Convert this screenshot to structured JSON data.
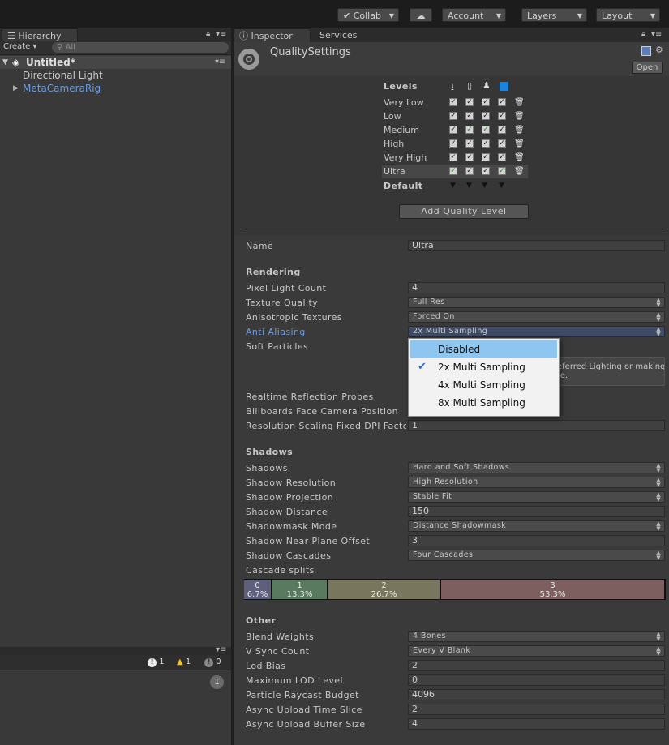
{
  "toolbar": {
    "collab": "Collab",
    "account": "Account",
    "layers": "Layers",
    "layout": "Layout"
  },
  "hierarchy": {
    "tab": "Hierarchy",
    "create": "Create",
    "search_placeholder": "All",
    "scene": "Untitled*",
    "items": [
      "Directional Light",
      "MetaCameraRig"
    ]
  },
  "console": {
    "errors": "1",
    "warnings": "1",
    "messages": "0",
    "collapsed_count": "1"
  },
  "inspector": {
    "tab": "Inspector",
    "services_tab": "Services",
    "title": "QualitySettings",
    "open": "Open",
    "levels_header": "Levels",
    "default_label": "Default",
    "levels": [
      {
        "name": "Very Low",
        "checks": [
          "✓",
          "✓",
          "✓",
          "✓"
        ],
        "green": [
          false,
          false,
          false,
          false
        ]
      },
      {
        "name": "Low",
        "checks": [
          "✓",
          "✓",
          "✓",
          "✓"
        ],
        "green": [
          false,
          false,
          false,
          false
        ]
      },
      {
        "name": "Medium",
        "checks": [
          "✓",
          "✓",
          "✓",
          "✓"
        ],
        "green": [
          false,
          true,
          true,
          false
        ]
      },
      {
        "name": "High",
        "checks": [
          "✓",
          "✓",
          "✓",
          "✓"
        ],
        "green": [
          false,
          false,
          false,
          false
        ]
      },
      {
        "name": "Very High",
        "checks": [
          "✓",
          "✓",
          "✓",
          "✓"
        ],
        "green": [
          false,
          false,
          false,
          false
        ]
      },
      {
        "name": "Ultra",
        "checks": [
          "✓",
          "✓",
          "✓",
          "✓"
        ],
        "green": [
          true,
          false,
          false,
          true
        ]
      }
    ],
    "add_level": "Add Quality Level",
    "name_label": "Name",
    "name_value": "Ultra",
    "rendering": {
      "header": "Rendering",
      "pixel_light_count": {
        "label": "Pixel Light Count",
        "value": "4"
      },
      "texture_quality": {
        "label": "Texture Quality",
        "value": "Full Res"
      },
      "anisotropic": {
        "label": "Anisotropic Textures",
        "value": "Forced On"
      },
      "anti_aliasing": {
        "label": "Anti Aliasing",
        "value": "2x Multi Sampling"
      },
      "soft_particles": {
        "label": "Soft Particles"
      },
      "info_text_1": "eferred Lighting or making",
      "info_text_2": "re.",
      "realtime_reflection": {
        "label": "Realtime Reflection Probes"
      },
      "billboards": {
        "label": "Billboards Face Camera Position"
      },
      "resolution_scaling": {
        "label": "Resolution Scaling Fixed DPI Factor",
        "value": "1"
      }
    },
    "aa_options": [
      "Disabled",
      "2x Multi Sampling",
      "4x Multi Sampling",
      "8x Multi Sampling"
    ],
    "shadows": {
      "header": "Shadows",
      "shadows": {
        "label": "Shadows",
        "value": "Hard and Soft Shadows"
      },
      "resolution": {
        "label": "Shadow Resolution",
        "value": "High Resolution"
      },
      "projection": {
        "label": "Shadow Projection",
        "value": "Stable Fit"
      },
      "distance": {
        "label": "Shadow Distance",
        "value": "150"
      },
      "shadowmask": {
        "label": "Shadowmask Mode",
        "value": "Distance Shadowmask"
      },
      "near_plane": {
        "label": "Shadow Near Plane Offset",
        "value": "3"
      },
      "cascades": {
        "label": "Shadow Cascades",
        "value": "Four Cascades"
      },
      "cascade_splits": {
        "label": "Cascade splits"
      },
      "splits": [
        {
          "index": "0",
          "pct": "6.7%",
          "fraction": 0.067,
          "color": "#5e5f7d"
        },
        {
          "index": "1",
          "pct": "13.3%",
          "fraction": 0.133,
          "color": "#5a7a5f"
        },
        {
          "index": "2",
          "pct": "26.7%",
          "fraction": 0.267,
          "color": "#78775e"
        },
        {
          "index": "3",
          "pct": "53.3%",
          "fraction": 0.533,
          "color": "#7d5f5f"
        }
      ]
    },
    "other": {
      "header": "Other",
      "blend_weights": {
        "label": "Blend Weights",
        "value": "4 Bones"
      },
      "vsync": {
        "label": "V Sync Count",
        "value": "Every V Blank"
      },
      "lod_bias": {
        "label": "Lod Bias",
        "value": "2"
      },
      "max_lod": {
        "label": "Maximum LOD Level",
        "value": "0"
      },
      "raycast_budget": {
        "label": "Particle Raycast Budget",
        "value": "4096"
      },
      "async_time": {
        "label": "Async Upload Time Slice",
        "value": "2"
      },
      "async_buffer": {
        "label": "Async Upload Buffer Size",
        "value": "4"
      }
    }
  }
}
